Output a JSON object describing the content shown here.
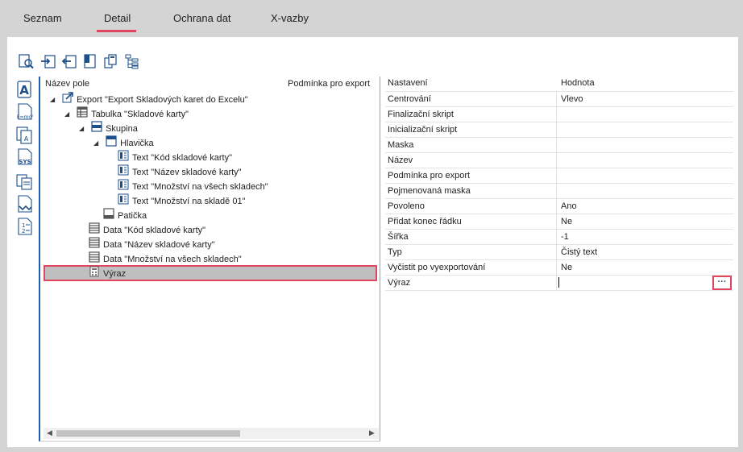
{
  "tabs": [
    {
      "label": "Seznam"
    },
    {
      "label": "Detail",
      "active": true
    },
    {
      "label": "Ochrana dat"
    },
    {
      "label": "X-vazby"
    }
  ],
  "colors": {
    "accent": "#e0465f",
    "selection": "#bfbfbf",
    "tree_border": "#1d5fb3"
  },
  "toolbar": {
    "icons": [
      "preview-icon",
      "import-icon",
      "export-icon",
      "page-icon",
      "copy-icon",
      "tree-structure-icon"
    ]
  },
  "left_strip": {
    "icons": [
      "text-field-icon",
      "formula-icon",
      "data-field-icon",
      "system-variable-icon",
      "copy-field-icon",
      "link-icon",
      "tab-order-icon"
    ]
  },
  "tree": {
    "header_name": "Název pole",
    "header_condition": "Podmínka pro export",
    "rows": [
      {
        "label": "Export \"Export Skladových karet do Excelu\""
      },
      {
        "label": "Tabulka \"Skladové karty\""
      },
      {
        "label": "Skupina"
      },
      {
        "label": "Hlavička"
      },
      {
        "label": "Text \"Kód skladové karty\""
      },
      {
        "label": "Text \"Název skladové karty\""
      },
      {
        "label": "Text \"Množství na všech skladech\""
      },
      {
        "label": "Text \"Množství na skladě 01\""
      },
      {
        "label": "Patička"
      },
      {
        "label": "Data \"Kód skladové karty\""
      },
      {
        "label": "Data \"Název skladové karty\""
      },
      {
        "label": "Data \"Množství na všech skladech\""
      },
      {
        "label": "Výraz"
      }
    ]
  },
  "properties": {
    "header_name": "Nastavení",
    "header_value": "Hodnota",
    "rows": [
      {
        "name": "Centrování",
        "value": "Vlevo"
      },
      {
        "name": "Finalizační skript",
        "value": ""
      },
      {
        "name": "Inicializační skript",
        "value": ""
      },
      {
        "name": "Maska",
        "value": ""
      },
      {
        "name": "Název",
        "value": ""
      },
      {
        "name": "Podmínka pro export",
        "value": ""
      },
      {
        "name": "Pojmenovaná maska",
        "value": ""
      },
      {
        "name": "Povoleno",
        "value": "Ano"
      },
      {
        "name": "Přidat konec řádku",
        "value": "Ne"
      },
      {
        "name": "Šířka",
        "value": "-1"
      },
      {
        "name": "Typ",
        "value": "Čistý text"
      },
      {
        "name": "Vyčistit po vyexportování",
        "value": "Ne"
      },
      {
        "name": "Výraz",
        "value": ""
      }
    ],
    "ellipsis_label": "···"
  }
}
